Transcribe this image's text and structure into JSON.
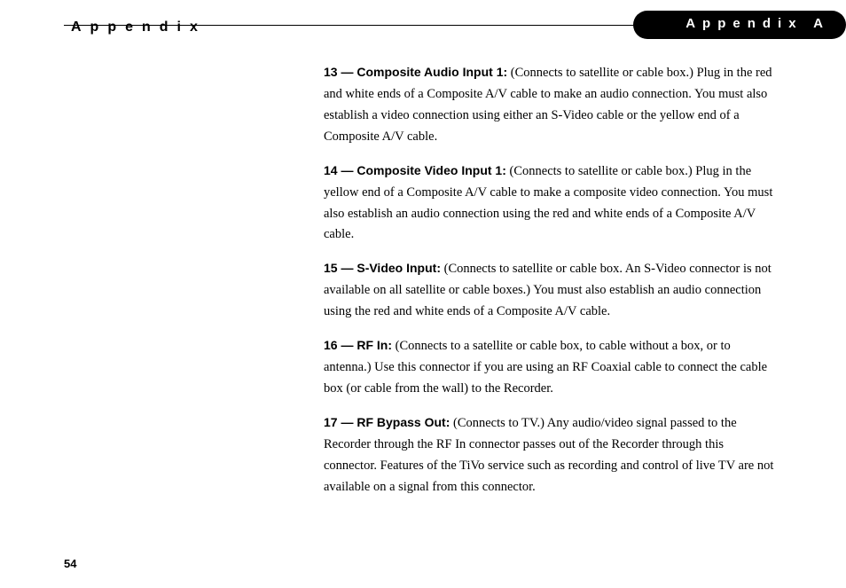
{
  "header": {
    "left": "Appendix",
    "right": "Appendix A"
  },
  "items": [
    {
      "label": "13 — Composite Audio Input 1:",
      "text": " (Connects to satellite or cable box.) Plug in the red and white ends of a Composite A/V cable to make an audio connection. You must also establish a video connection using either an S-Video cable or the yellow end of a Composite A/V cable."
    },
    {
      "label": "14 — Composite Video Input 1:",
      "text": " (Connects to satellite or cable box.) Plug in the yellow end of a Composite A/V cable to make a composite video connection. You must also establish an audio connection using the red and white ends of a Composite A/V cable."
    },
    {
      "label": "15 — S-Video Input:",
      "text": " (Connects to satellite or cable box. An S-Video connector is not available on all satellite or cable boxes.) You must also establish an audio connection using the red and white ends of a Composite A/V cable."
    },
    {
      "label": "16 — RF In:",
      "text": " (Connects to a satellite or cable box, to cable without a box, or to antenna.) Use this connector if you are using an RF Coaxial cable to connect the cable box (or cable from the wall) to the Recorder."
    },
    {
      "label": "17 — RF Bypass Out:",
      "text": " (Connects to TV.) Any audio/video signal passed to the Recorder through the RF In connector passes out of the Recorder through this connector. Features of the TiVo service such as recording and control of live TV are not available on a signal from this connector."
    }
  ],
  "pageNumber": "54"
}
